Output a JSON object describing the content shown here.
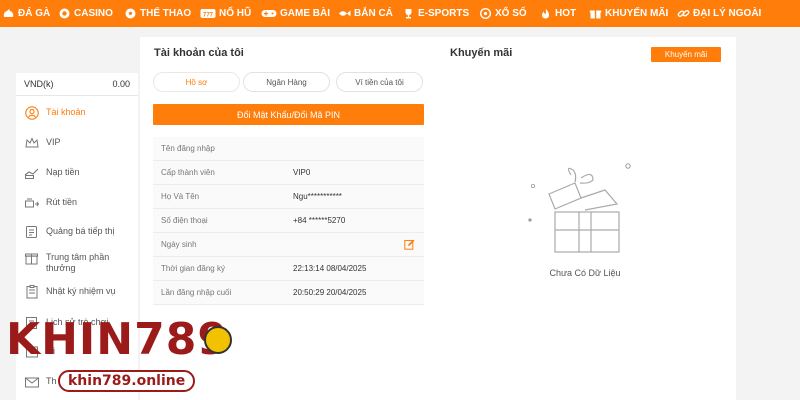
{
  "nav": {
    "items": [
      {
        "label": "ĐÁ GÀ",
        "icon": "rooster-icon"
      },
      {
        "label": "CASINO",
        "icon": "chip-icon"
      },
      {
        "label": "THỂ THAO",
        "icon": "soccer-ball-icon"
      },
      {
        "label": "NỔ HŨ",
        "icon": "slot-icon"
      },
      {
        "label": "GAME BÀI",
        "icon": "gamepad-icon"
      },
      {
        "label": "BẮN CÁ",
        "icon": "fish-icon"
      },
      {
        "label": "E-SPORTS",
        "icon": "trophy-icon"
      },
      {
        "label": "XỔ SỐ",
        "icon": "lottery-icon"
      },
      {
        "label": "HOT",
        "icon": "fire-icon"
      },
      {
        "label": "KHUYẾN MÃI",
        "icon": "gift-icon"
      },
      {
        "label": "ĐẠI LÝ NGOÀI",
        "icon": "link-icon"
      }
    ]
  },
  "sidebar": {
    "currency": "VND(k)",
    "balance": "0.00",
    "items": [
      {
        "label": "Tài khoản",
        "icon": "user-icon",
        "active": true
      },
      {
        "label": "VIP",
        "icon": "vip-crown-icon"
      },
      {
        "label": "Nạp tiền",
        "icon": "deposit-icon"
      },
      {
        "label": "Rút tiền",
        "icon": "withdraw-icon"
      },
      {
        "label": "Quảng bá tiếp thị",
        "icon": "promote-icon"
      },
      {
        "label": "Trung tâm phần thưởng",
        "icon": "reward-icon"
      },
      {
        "label": "Nhật ký nhiệm vụ",
        "icon": "task-log-icon"
      },
      {
        "label": "Lịch sử trò chơi",
        "icon": "history-icon"
      },
      {
        "label": "Gi",
        "icon": "transaction-icon"
      },
      {
        "label": "Th",
        "icon": "mail-icon"
      }
    ]
  },
  "account": {
    "title": "Tài khoản của tôi",
    "tabs": [
      "Hồ sơ",
      "Ngân Hàng",
      "Ví tiền của tôi"
    ],
    "change_password_label": "Đổi Mật Khẩu/Đổi Mã PIN",
    "rows": [
      {
        "label": "Tên đăng nhập",
        "value": ""
      },
      {
        "label": "Cấp thành viên",
        "value": "VIP0"
      },
      {
        "label": "Họ Và Tên",
        "value": "Ngu***********"
      },
      {
        "label": "Số điện thoại",
        "value": "+84 ******5270"
      },
      {
        "label": "Ngày sinh",
        "value": "",
        "editable": true
      },
      {
        "label": "Thời gian đăng ký",
        "value": "22:13:14 08/04/2025"
      },
      {
        "label": "Lần đăng nhập cuối",
        "value": "20:50:29 20/04/2025"
      }
    ]
  },
  "promotion": {
    "title": "Khuyến mãi",
    "button_label": "Khuyến mãi",
    "empty_text": "Chưa Có Dữ Liệu"
  },
  "watermark": {
    "brand": "KHIN789",
    "site": "khin789.online"
  },
  "colors": {
    "accent": "#ff7d0a",
    "logo": "#9b1b1b"
  }
}
